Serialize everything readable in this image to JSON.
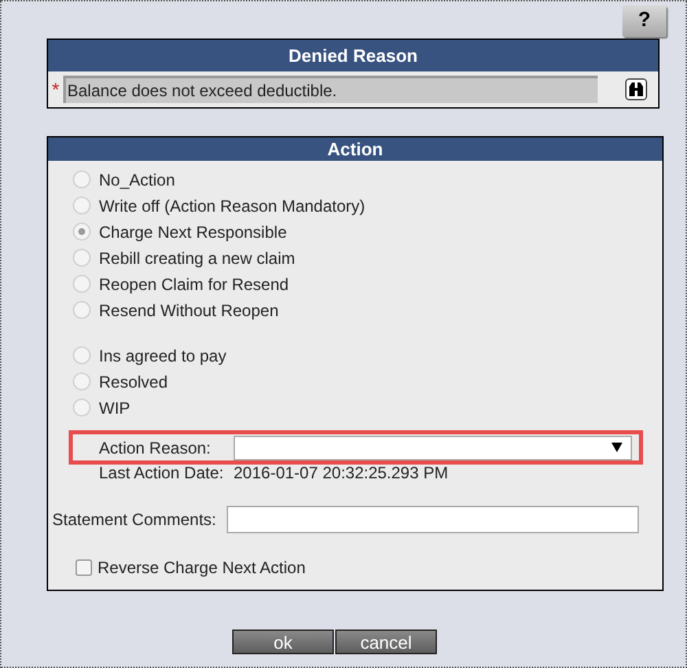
{
  "help_button": "?",
  "denied_reason": {
    "title": "Denied Reason",
    "required_mark": "*",
    "value": "Balance does not exceed deductible."
  },
  "action": {
    "title": "Action",
    "option_groups": [
      [
        {
          "label": "No_Action",
          "selected": false
        },
        {
          "label": "Write off (Action Reason Mandatory)",
          "selected": false
        },
        {
          "label": "Charge Next Responsible",
          "selected": true
        },
        {
          "label": "Rebill creating a new claim",
          "selected": false
        },
        {
          "label": "Reopen Claim for Resend",
          "selected": false
        },
        {
          "label": "Resend Without Reopen",
          "selected": false
        }
      ],
      [
        {
          "label": "Ins agreed to pay",
          "selected": false
        },
        {
          "label": "Resolved",
          "selected": false
        },
        {
          "label": "WIP",
          "selected": false
        }
      ]
    ],
    "action_reason": {
      "label": "Action Reason:",
      "highlighted": true
    },
    "last_action_date": {
      "label": "Last Action Date:",
      "value": "2016-01-07 20:32:25.293 PM"
    },
    "statement_comments": {
      "label": "Statement Comments:"
    },
    "reverse_option": {
      "label": "Reverse Charge Next Action",
      "checked": false
    }
  },
  "buttons": [
    "ok",
    "cancel"
  ]
}
